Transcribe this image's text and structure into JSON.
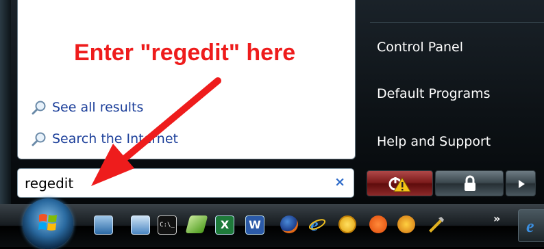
{
  "annotation": {
    "text": "Enter \"regedit\" here",
    "color": "#ee1c1c"
  },
  "results": {
    "see_all": "See all results",
    "search_internet": "Search the Internet"
  },
  "search": {
    "value": "regedit",
    "clear_label": "×"
  },
  "right_panel": {
    "items": [
      "Control Panel",
      "Default Programs",
      "Help and Support"
    ]
  },
  "power": {
    "power_icon": "power-icon",
    "lock_icon": "lock-icon",
    "arrow_icon": "arrow-right-icon"
  },
  "taskbar": {
    "more_label": "»",
    "icons": [
      "show-desktop-icon",
      "switch-windows-icon",
      "command-prompt-icon",
      "notes-icon",
      "excel-icon",
      "word-icon",
      "firefox-icon",
      "internet-explorer-icon",
      "globe-icon",
      "orange-app-icon",
      "game-icon",
      "tool-icon"
    ]
  }
}
